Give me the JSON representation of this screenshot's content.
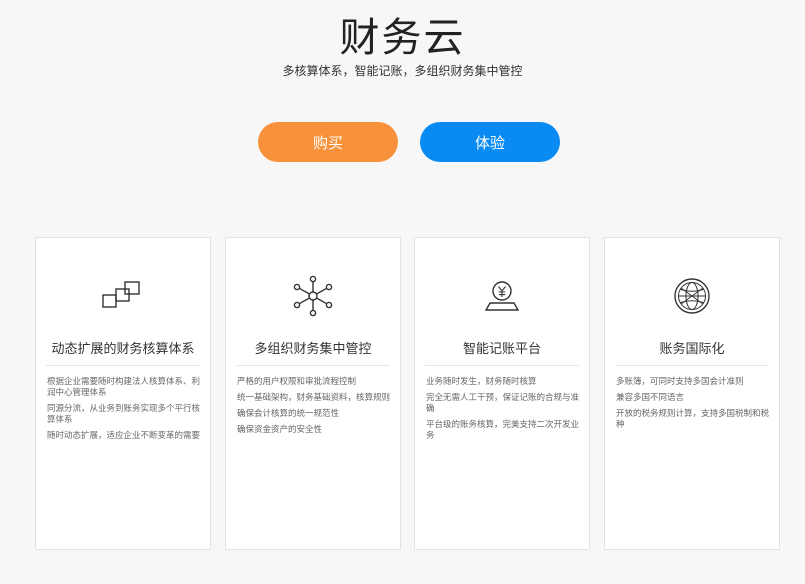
{
  "hero": {
    "title": "财务云",
    "subtitle": "多核算体系，智能记账，多组织财务集中管控"
  },
  "buttons": {
    "buy_label": "购买",
    "try_label": "体验"
  },
  "colors": {
    "buy_button": "#f7913a",
    "try_button": "#0a8bf4",
    "icon_stroke": "#333333"
  },
  "cards": [
    {
      "icon": "stacked-squares-icon",
      "title": "动态扩展的财务核算体系",
      "features": [
        "根据企业需要随时构建法人核算体系、利润中心管理体系",
        "同源分流，从业务到账务实现多个平行核算体系",
        "随时动态扩展，适应企业不断变革的需要"
      ]
    },
    {
      "icon": "network-hub-icon",
      "title": "多组织财务集中管控",
      "features": [
        "严格的用户权限和审批流程控制",
        "统一基础架构，财务基础资料，核算规则",
        "确保会计核算的统一规范性",
        "确保资金资产的安全性"
      ]
    },
    {
      "icon": "yen-coin-tray-icon",
      "title": "智能记账平台",
      "features": [
        "业务随时发生，财务随时核算",
        "完全无需人工干预，保证记账的合规与准确",
        "平台级的账务核算，完美支持二次开发业务"
      ]
    },
    {
      "icon": "globe-icon",
      "title": "账务国际化",
      "features": [
        "多账簿，可同时支持多国会计准则",
        "兼容多国不同语言",
        "开放的税务规则计算，支持多国税制和税种"
      ]
    }
  ]
}
